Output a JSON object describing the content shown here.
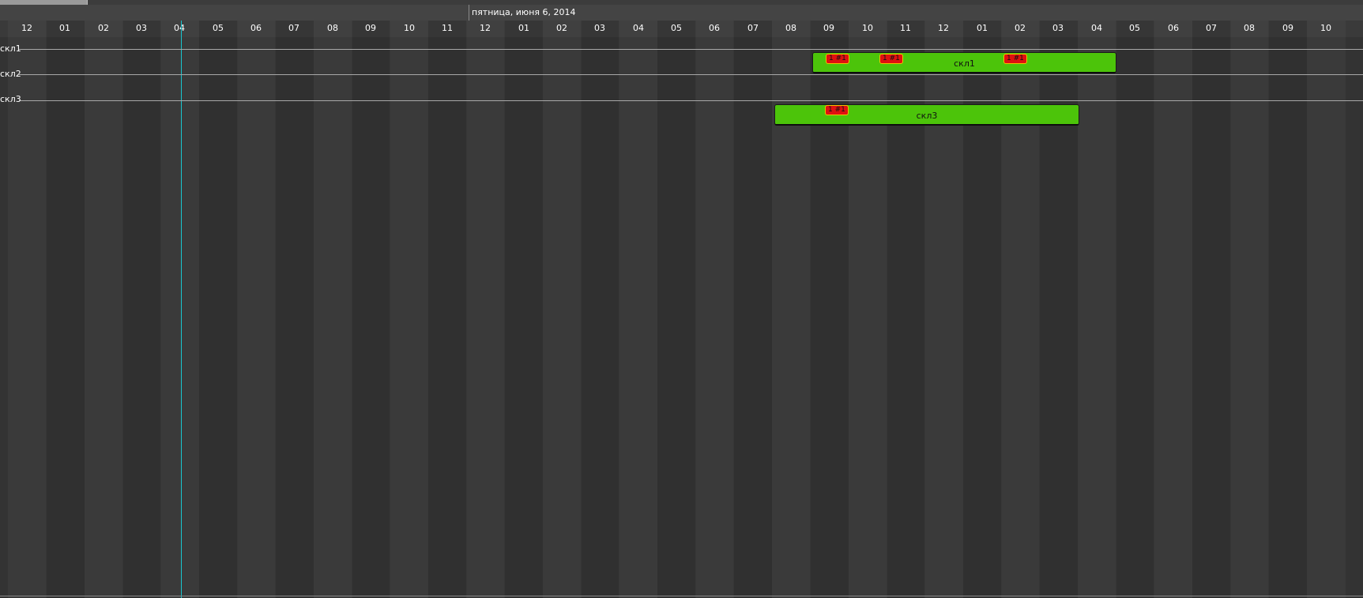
{
  "header": {
    "date_label": "пятница, июня 6, 2014"
  },
  "timeline": {
    "hours": [
      "12",
      "01",
      "02",
      "03",
      "04",
      "05",
      "06",
      "07",
      "08",
      "09",
      "10",
      "11",
      "12",
      "01",
      "02",
      "03",
      "04",
      "05",
      "06",
      "07",
      "08",
      "09",
      "10",
      "11",
      "12",
      "01",
      "02",
      "03",
      "04",
      "05",
      "06",
      "07",
      "08",
      "09",
      "10"
    ]
  },
  "rows": [
    {
      "label": "скл1"
    },
    {
      "label": "скл2"
    },
    {
      "label": "скл3"
    }
  ],
  "tasks": [
    {
      "label": "скл1",
      "markers": [
        "1 #1",
        "1 #1",
        "1 #1"
      ]
    },
    {
      "label": "скл3",
      "markers": [
        "1 #1"
      ]
    }
  ],
  "colors": {
    "task_fill": "#4cc40a",
    "marker_fill": "#e01010",
    "marker_border": "#f2c200",
    "now_line": "#18c6d0",
    "background": "#333333"
  }
}
